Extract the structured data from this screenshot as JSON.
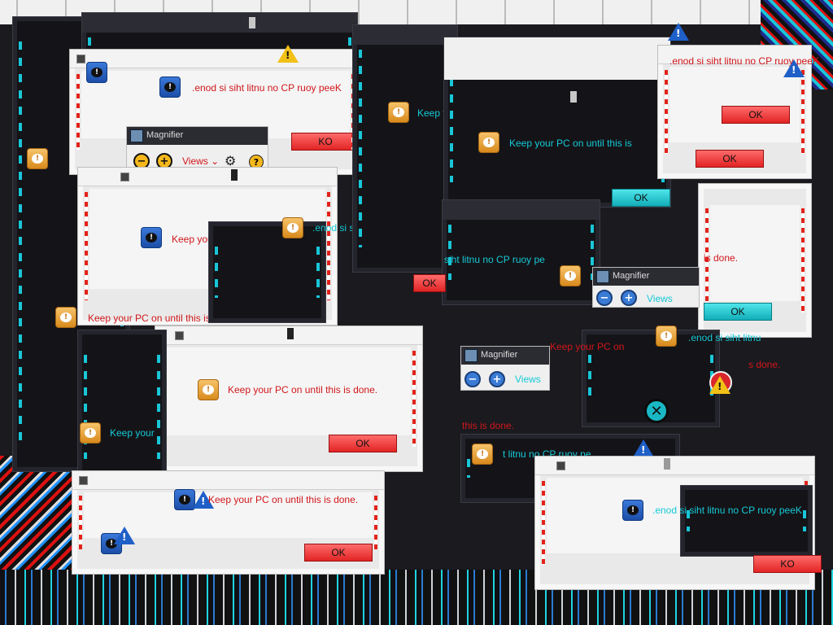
{
  "dialogs": {
    "message": "Keep your PC on until this is done.",
    "message_reversed": ".enod si siht litnu no CP ruoy peeK",
    "message_partial_1": "Keep your PC on",
    "message_partial_2": "Keep y",
    "message_partial_3": "Keep your",
    "message_partial_4": "siht litnu no CP ruoy pe",
    "message_partial_5": "Keep your PC on",
    "message_partial_6": ".enod si siht litnu no CP ruoy p",
    "message_fragment_1": "Keep your PC on until this is",
    "message_fragment_2": "Keep your PC on until this is",
    "message_fragment_3": ".enod si siht litnu",
    "message_fragment_4": "t litnu no CP ruoy pe",
    "message_fragment_5": "is done.",
    "message_fragment_6": "this is done.",
    "message_fragment_7": "s done.",
    "ok_label": "OK",
    "ok_label_reversed": "KO"
  },
  "magnifier": {
    "title": "Magnifier",
    "views_label": "Views",
    "zoom_out": "−",
    "zoom_in": "+",
    "views_chevron": "⌄",
    "settings_icon": "⚙",
    "help_icon": "?"
  },
  "colors": {
    "accent_red": "#d1171b",
    "accent_cyan": "#16c9d6",
    "dark_bg": "#141418",
    "light_bg": "#e9e9e9"
  },
  "icons": [
    "info-icon",
    "warning-icon",
    "warning-triangle-icon",
    "error-icon",
    "magnifier-icon"
  ]
}
